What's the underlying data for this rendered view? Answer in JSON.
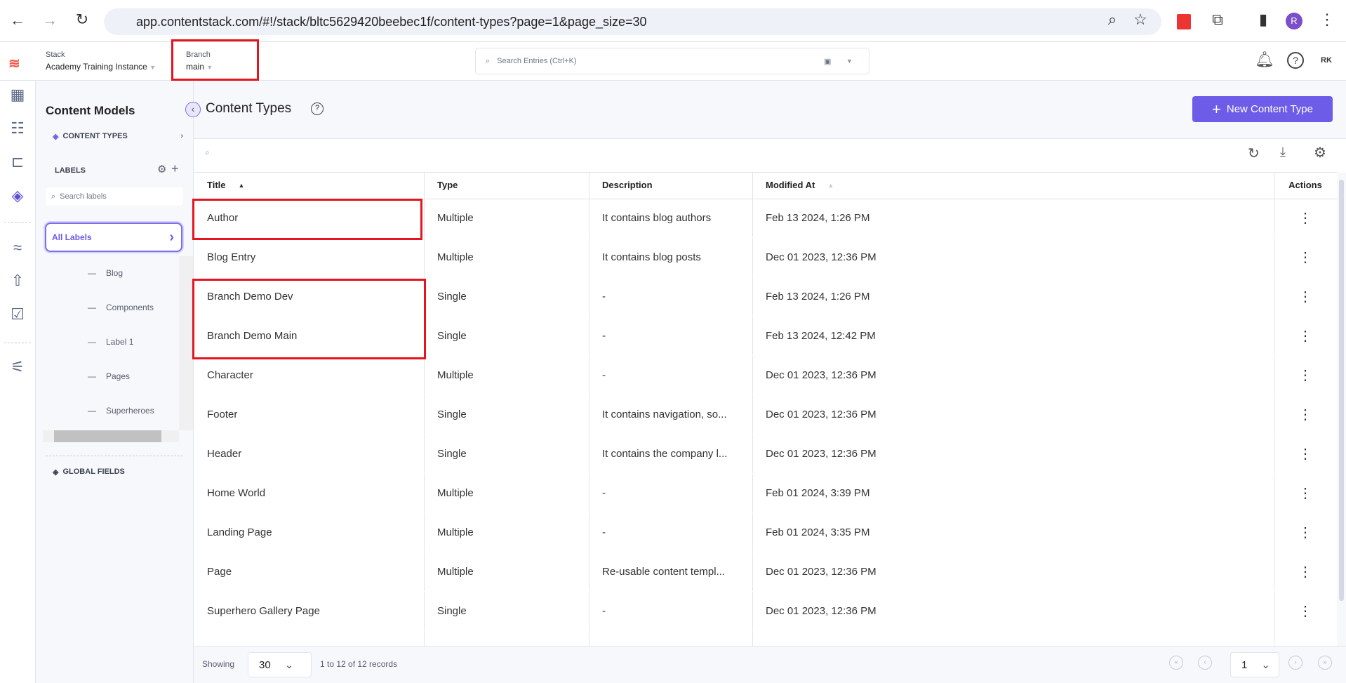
{
  "browser": {
    "url": "app.contentstack.com/#!/stack/bltc5629420beebec1f/content-types?page=1&page_size=30",
    "profile": "R"
  },
  "header": {
    "stack_label": "Stack",
    "stack_name": "Academy Training Instance",
    "branch_label": "Branch",
    "branch_name": "main",
    "search_placeholder": "Search Entries (Ctrl+K)",
    "user_initials": "RK"
  },
  "sidebar": {
    "title": "Content Models",
    "content_types": "CONTENT TYPES",
    "labels_heading": "LABELS",
    "search_placeholder": "Search labels",
    "all_labels": "All Labels",
    "labels": [
      "Blog",
      "Components",
      "Label 1",
      "Pages",
      "Superheroes"
    ],
    "global_fields": "GLOBAL FIELDS"
  },
  "main": {
    "title": "Content Types",
    "new_button": "New Content Type",
    "columns": [
      "Title",
      "Type",
      "Description",
      "Modified At",
      "Actions"
    ],
    "rows": [
      [
        "Author",
        "Multiple",
        "It contains blog authors",
        "Feb 13 2024, 1:26 PM"
      ],
      [
        "Blog Entry",
        "Multiple",
        "It contains blog posts",
        "Dec 01 2023, 12:36 PM"
      ],
      [
        "Branch Demo Dev",
        "Single",
        "-",
        "Feb 13 2024, 1:26 PM"
      ],
      [
        "Branch Demo Main",
        "Single",
        "-",
        "Feb 13 2024, 12:42 PM"
      ],
      [
        "Character",
        "Multiple",
        "-",
        "Dec 01 2023, 12:36 PM"
      ],
      [
        "Footer",
        "Single",
        "It contains navigation, so...",
        "Dec 01 2023, 12:36 PM"
      ],
      [
        "Header",
        "Single",
        "It contains the company l...",
        "Dec 01 2023, 12:36 PM"
      ],
      [
        "Home World",
        "Multiple",
        "-",
        "Feb 01 2024, 3:39 PM"
      ],
      [
        "Landing Page",
        "Multiple",
        "-",
        "Feb 01 2024, 3:35 PM"
      ],
      [
        "Page",
        "Multiple",
        "Re-usable content templ...",
        "Dec 01 2023, 12:36 PM"
      ],
      [
        "Superhero Gallery Page",
        "Single",
        "-",
        "Dec 01 2023, 12:36 PM"
      ]
    ]
  },
  "footer": {
    "showing": "Showing",
    "page_size": "30",
    "records": "1 to 12 of 12 records",
    "page": "1"
  },
  "colors": {
    "accent": "#6c5ce7",
    "highlight": "#e5141e"
  }
}
